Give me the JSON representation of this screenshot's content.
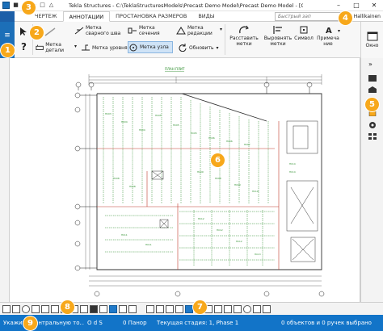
{
  "titlebar": {
    "title": "Tekla Structures - C:\\TeklaStructuresModels\\Precast Demo Model\\Precast Demo Model - [G...",
    "minimize": "–",
    "maximize": "□",
    "close": "✕",
    "quick_access": [
      "■",
      "↶",
      "↷",
      "□",
      "△"
    ]
  },
  "tabs": [
    {
      "label": "ЧЕРТЕЖ"
    },
    {
      "label": "АННОТАЦИИ"
    },
    {
      "label": "ПРОСТАНОВКА РАЗМЕРОВ"
    },
    {
      "label": "ВИДЫ"
    }
  ],
  "quick_search": {
    "placeholder": "Быстрый зап"
  },
  "user": {
    "name": "Päivi Hallikainen"
  },
  "ribbon": {
    "weld_mark": "Метка\nсварного шва",
    "section_mark": "Метка\nсечения",
    "revision_mark": "Метка\nредакции",
    "part_mark": "Метка детали",
    "level_mark": "Метка уровня",
    "node_mark": "Метка узла",
    "update": "Обновить",
    "arrange_marks": "Расставить\nметки",
    "align_marks": "Выровнять\nметки",
    "symbol": "Символ",
    "note": "Примеча\nние",
    "window": "Окно"
  },
  "drawing": {
    "title_label": "ПЛАН ПЛИТ"
  },
  "statusbar": {
    "prompt": "Укажите центральную то...",
    "snap": "O d S",
    "pan": "0  Панор",
    "phase": "Текущая стадия: 1, Phase 1",
    "selection": "0 объектов и 0 ручек выбрано"
  },
  "callouts": [
    "1",
    "2",
    "3",
    "4",
    "5",
    "6",
    "7",
    "8",
    "9"
  ],
  "colors": {
    "accent": "#1274c8",
    "callout": "#f7a81b",
    "drawing_green": "#2a8c2a",
    "drawing_red": "#c0392b"
  }
}
